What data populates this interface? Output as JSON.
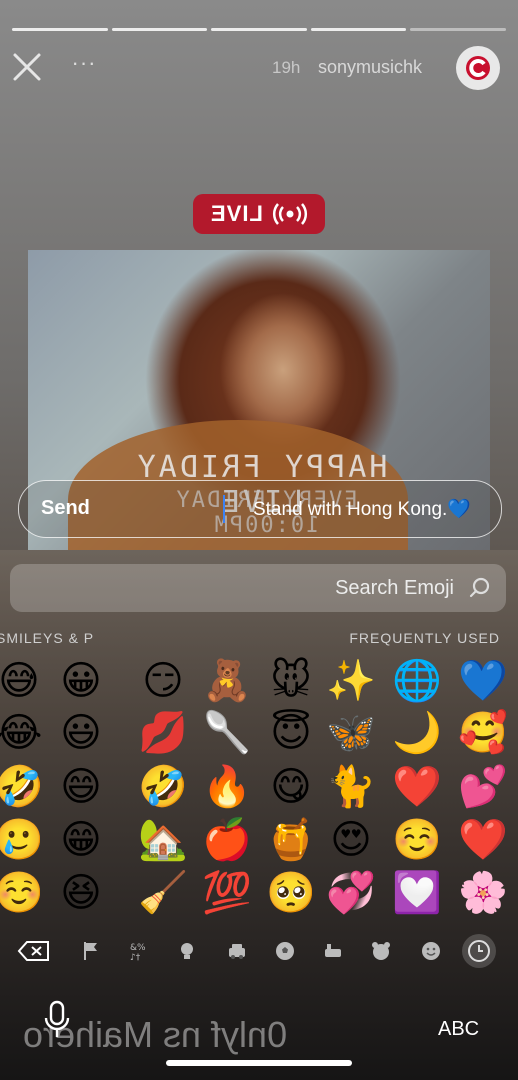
{
  "story": {
    "progress_segments": [
      1,
      1,
      1,
      1,
      0.9
    ],
    "username": "sonymusichk",
    "time": "19h",
    "more_label": "···",
    "live_label": "LIVE",
    "photo_title": "HAPPY FRIDAY LIVE",
    "photo_subtitle": "EVERY FRIDAY 10:00PM"
  },
  "reply": {
    "text": "Stand with Hong Kong.💙",
    "send_label": "Send"
  },
  "keyboard": {
    "search_placeholder": "Search Emoji",
    "category_frequent": "FREQUENTLY USED",
    "category_smileys": "SMILEYS & P",
    "emoji_columns": [
      [
        "💙",
        "🥰",
        "💕",
        "❤️",
        "🌸"
      ],
      [
        "🌐",
        "🌙",
        "❤️",
        "☺️",
        "💟"
      ],
      [
        "✨",
        "🦋",
        "🐈",
        "😍",
        "💞"
      ],
      [
        "🐭",
        "😇",
        "😋",
        "🍯",
        "🥺"
      ],
      [
        "🧸",
        "🥄",
        "🔥",
        "🍎",
        "💯"
      ],
      [
        "😏",
        "💋",
        "🤣",
        "🏡",
        "🧹"
      ],
      [
        "😀",
        "😃",
        "😄",
        "😁",
        "😆"
      ],
      [
        "😅",
        "😂",
        "🤣",
        "🥲",
        "☺️"
      ]
    ],
    "toolbar_icons": [
      "clock-icon",
      "smiley-icon",
      "animal-icon",
      "food-icon",
      "ball-icon",
      "car-icon",
      "bulb-icon",
      "symbols-icon",
      "flag-icon",
      "delete-icon"
    ],
    "abc_label": "ABC",
    "behind_text": "0nlyf ns Maihero"
  }
}
